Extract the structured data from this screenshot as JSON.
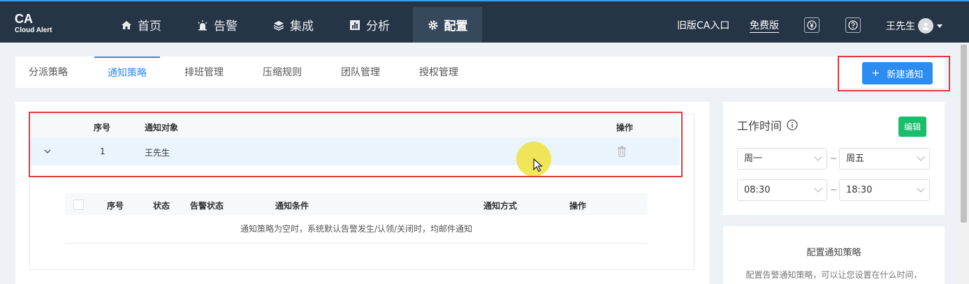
{
  "logo": {
    "title": "CA",
    "subtitle": "Cloud Alert"
  },
  "nav": [
    {
      "label": "首页",
      "icon": "home-icon"
    },
    {
      "label": "告警",
      "icon": "alarm-icon"
    },
    {
      "label": "集成",
      "icon": "layers-icon"
    },
    {
      "label": "分析",
      "icon": "bar-chart-icon"
    },
    {
      "label": "配置",
      "icon": "gear-icon",
      "active": true
    }
  ],
  "topright": {
    "old_entry": "旧版CA入口",
    "plan": "免费版",
    "currency_icon": "yen-icon",
    "help_icon": "help-icon",
    "user_name": "王先生"
  },
  "tabs": [
    {
      "label": "分派策略"
    },
    {
      "label": "通知策略",
      "active": true
    },
    {
      "label": "排班管理"
    },
    {
      "label": "压缩规则"
    },
    {
      "label": "团队管理"
    },
    {
      "label": "授权管理"
    }
  ],
  "new_button": {
    "icon": "+",
    "label": "新建通知"
  },
  "table": {
    "headers": {
      "index": "序号",
      "target": "通知对象",
      "action": "操作"
    },
    "rows": [
      {
        "index": "1",
        "target": "王先生"
      }
    ]
  },
  "subtable": {
    "headers": {
      "index": "序号",
      "status": "状态",
      "alert_status": "告警状态",
      "condition": "通知条件",
      "method": "通知方式",
      "action": "操作"
    },
    "empty_text": "通知策略为空时，系统默认告警发生/认领/关闭时，均邮件通知"
  },
  "worktime": {
    "title": "工作时间",
    "edit_label": "编辑",
    "day_from": "周一",
    "day_to": "周五",
    "time_from": "08:30",
    "time_to": "18:30",
    "separator": "~"
  },
  "config_panel": {
    "title": "配置通知策略",
    "desc": "配置告警通知策略，可以让您设置在什么时间，"
  },
  "colors": {
    "topbar": "#263545",
    "accent": "#2d8cf0",
    "edit_green": "#19be6b",
    "highlight_red": "#e0393e"
  }
}
